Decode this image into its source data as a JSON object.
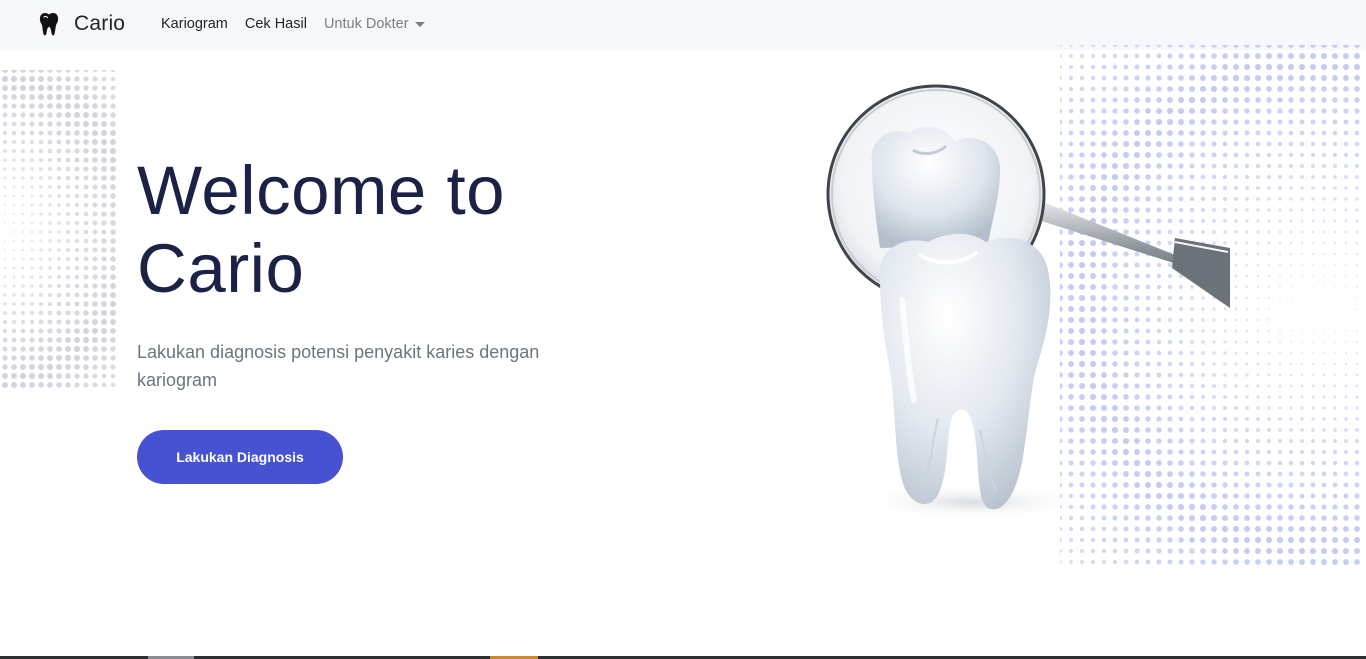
{
  "navbar": {
    "brand_icon": "tooth-icon",
    "brand_name": "Cario",
    "links": [
      {
        "label": "Kariogram"
      },
      {
        "label": "Cek Hasil"
      }
    ],
    "dropdown": {
      "label": "Untuk Dokter",
      "icon": "caret-down-icon"
    }
  },
  "hero": {
    "title_line1": "Welcome to",
    "title_line2": "Cario",
    "subtitle": "Lakukan diagnosis potensi penyakit karies dengan kariogram",
    "cta_label": "Lakukan Diagnosis"
  },
  "colors": {
    "accent": "#4652d2",
    "title": "#1c2146",
    "muted": "#6c757d",
    "navbar_bg": "#f7f8fb"
  }
}
